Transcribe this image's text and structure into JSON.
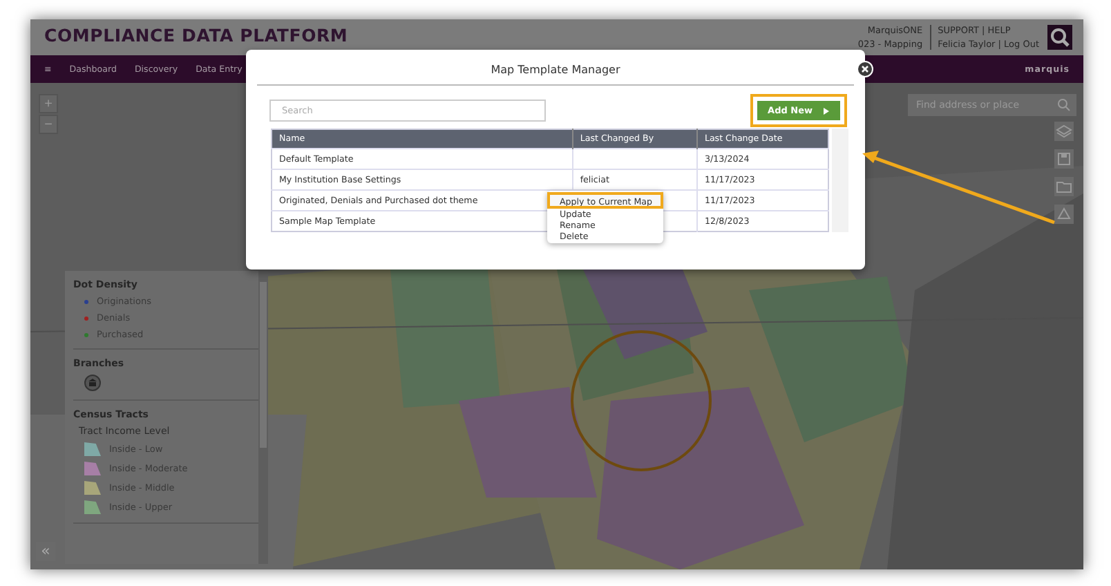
{
  "header": {
    "title": "COMPLIANCE DATA PLATFORM",
    "links_left": [
      "MarquisONE",
      "023 - Mapping"
    ],
    "links_right": [
      "SUPPORT | HELP",
      "Felicia Taylor | Log Out"
    ],
    "logo": "marquis"
  },
  "nav": {
    "menu_icon": "≡",
    "items": [
      "Dashboard",
      "Discovery",
      "Data Entry"
    ]
  },
  "map": {
    "kind": "picture",
    "collapse": "«",
    "zoom": [
      "+",
      "−"
    ],
    "search": {
      "placeholder": "Find address or place"
    }
  },
  "legend": {
    "sections": [
      {
        "title": "Dot Density",
        "kind": "dots",
        "items": [
          {
            "label": "Originations",
            "color": "#2a3f8f"
          },
          {
            "label": "Denials",
            "color": "#a02020"
          },
          {
            "label": "Purchased",
            "color": "#2f7a2f"
          }
        ]
      },
      {
        "title": "Branches",
        "kind": "icons"
      },
      {
        "title": "Census Tracts",
        "subtitle": "Tract Income Level",
        "kind": "swatches",
        "items": [
          {
            "label": "Inside - Low",
            "color": "#7fa9a6"
          },
          {
            "label": "Inside - Moderate",
            "color": "#a77fa6"
          },
          {
            "label": "Inside - Middle",
            "color": "#a8a67a"
          },
          {
            "label": "Inside - Upper",
            "color": "#7fa77f"
          }
        ]
      }
    ]
  },
  "dialog": {
    "title": "Map Template Manager",
    "search": {
      "placeholder": "Search"
    },
    "add_button": "Add New",
    "table": {
      "columns": [
        "Name",
        "Last Changed By",
        "Last Change Date"
      ],
      "rows": [
        {
          "name": "Default Template",
          "changed_by": "",
          "date": "3/13/2024"
        },
        {
          "name": "My Institution Base Settings",
          "changed_by": "feliciat",
          "date": "11/17/2023"
        },
        {
          "name": "Originated, Denials and Purchased dot theme",
          "changed_by": "",
          "date": "11/17/2023"
        },
        {
          "name": "Sample Map Template",
          "changed_by": "",
          "date": "12/8/2023"
        }
      ]
    },
    "context_menu": [
      {
        "label": "Apply to Current Map",
        "highlighted": true
      },
      {
        "label": "Update",
        "highlighted": false
      },
      {
        "label": "Rename",
        "highlighted": false
      },
      {
        "label": "Delete",
        "highlighted": false
      }
    ]
  }
}
